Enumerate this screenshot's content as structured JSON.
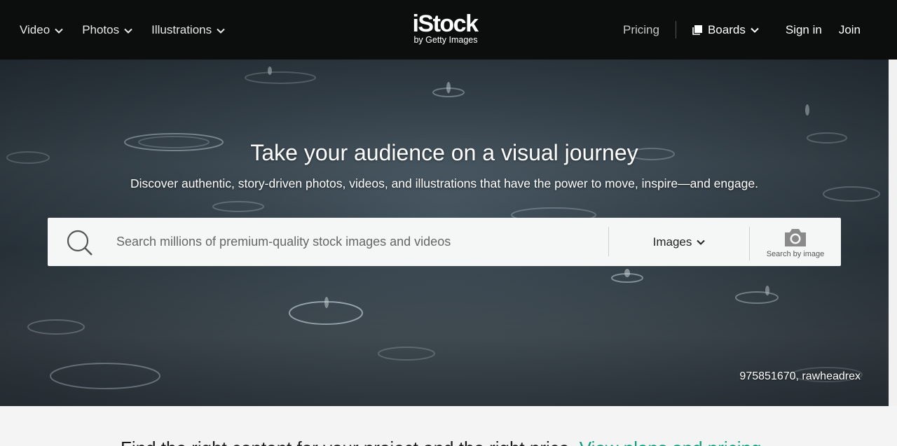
{
  "header": {
    "nav_left": [
      {
        "label": "Video"
      },
      {
        "label": "Photos"
      },
      {
        "label": "Illustrations"
      }
    ],
    "logo": {
      "brand": "iStock",
      "sub": "by Getty Images"
    },
    "pricing": "Pricing",
    "boards": "Boards",
    "sign_in": "Sign in",
    "join": "Join"
  },
  "hero": {
    "title": "Take your audience on a visual journey",
    "subtitle": "Discover authentic, story-driven photos, videos, and illustrations that have the power to move, inspire—and engage.",
    "search": {
      "placeholder": "Search millions of premium-quality stock images and videos",
      "type_selected": "Images",
      "search_by_image": "Search by image"
    },
    "credit": "975851670, rawheadrex"
  },
  "below": {
    "text": "Find the right content for your project and the right price.",
    "link": "View plans and pricing"
  },
  "colors": {
    "header_bg": "#0c0d0d",
    "accent_link": "#08a17b",
    "search_bg": "#f5f6f6"
  }
}
